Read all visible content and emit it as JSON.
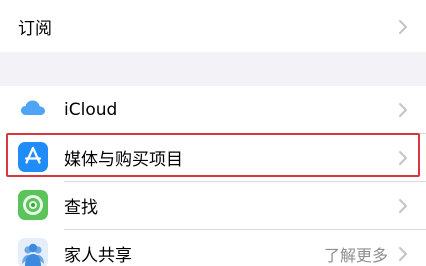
{
  "groups": {
    "top": {
      "row": {
        "label": "订阅"
      }
    },
    "bottom": {
      "rows": [
        {
          "label": "iCloud",
          "icon": "icloud-icon"
        },
        {
          "label": "媒体与购买项目",
          "icon": "app-store-icon",
          "highlighted": true
        },
        {
          "label": "查找",
          "icon": "find-my-icon"
        },
        {
          "label": "家人共享",
          "icon": "family-sharing-icon",
          "detail": "了解更多"
        }
      ]
    }
  },
  "colors": {
    "background": "#f2f2f7",
    "highlight_border": "#d9373d",
    "app_store_blue": "#1f8cf8",
    "icloud_blue": "#4fa4f5",
    "find_my_green": "#5ac35a"
  }
}
